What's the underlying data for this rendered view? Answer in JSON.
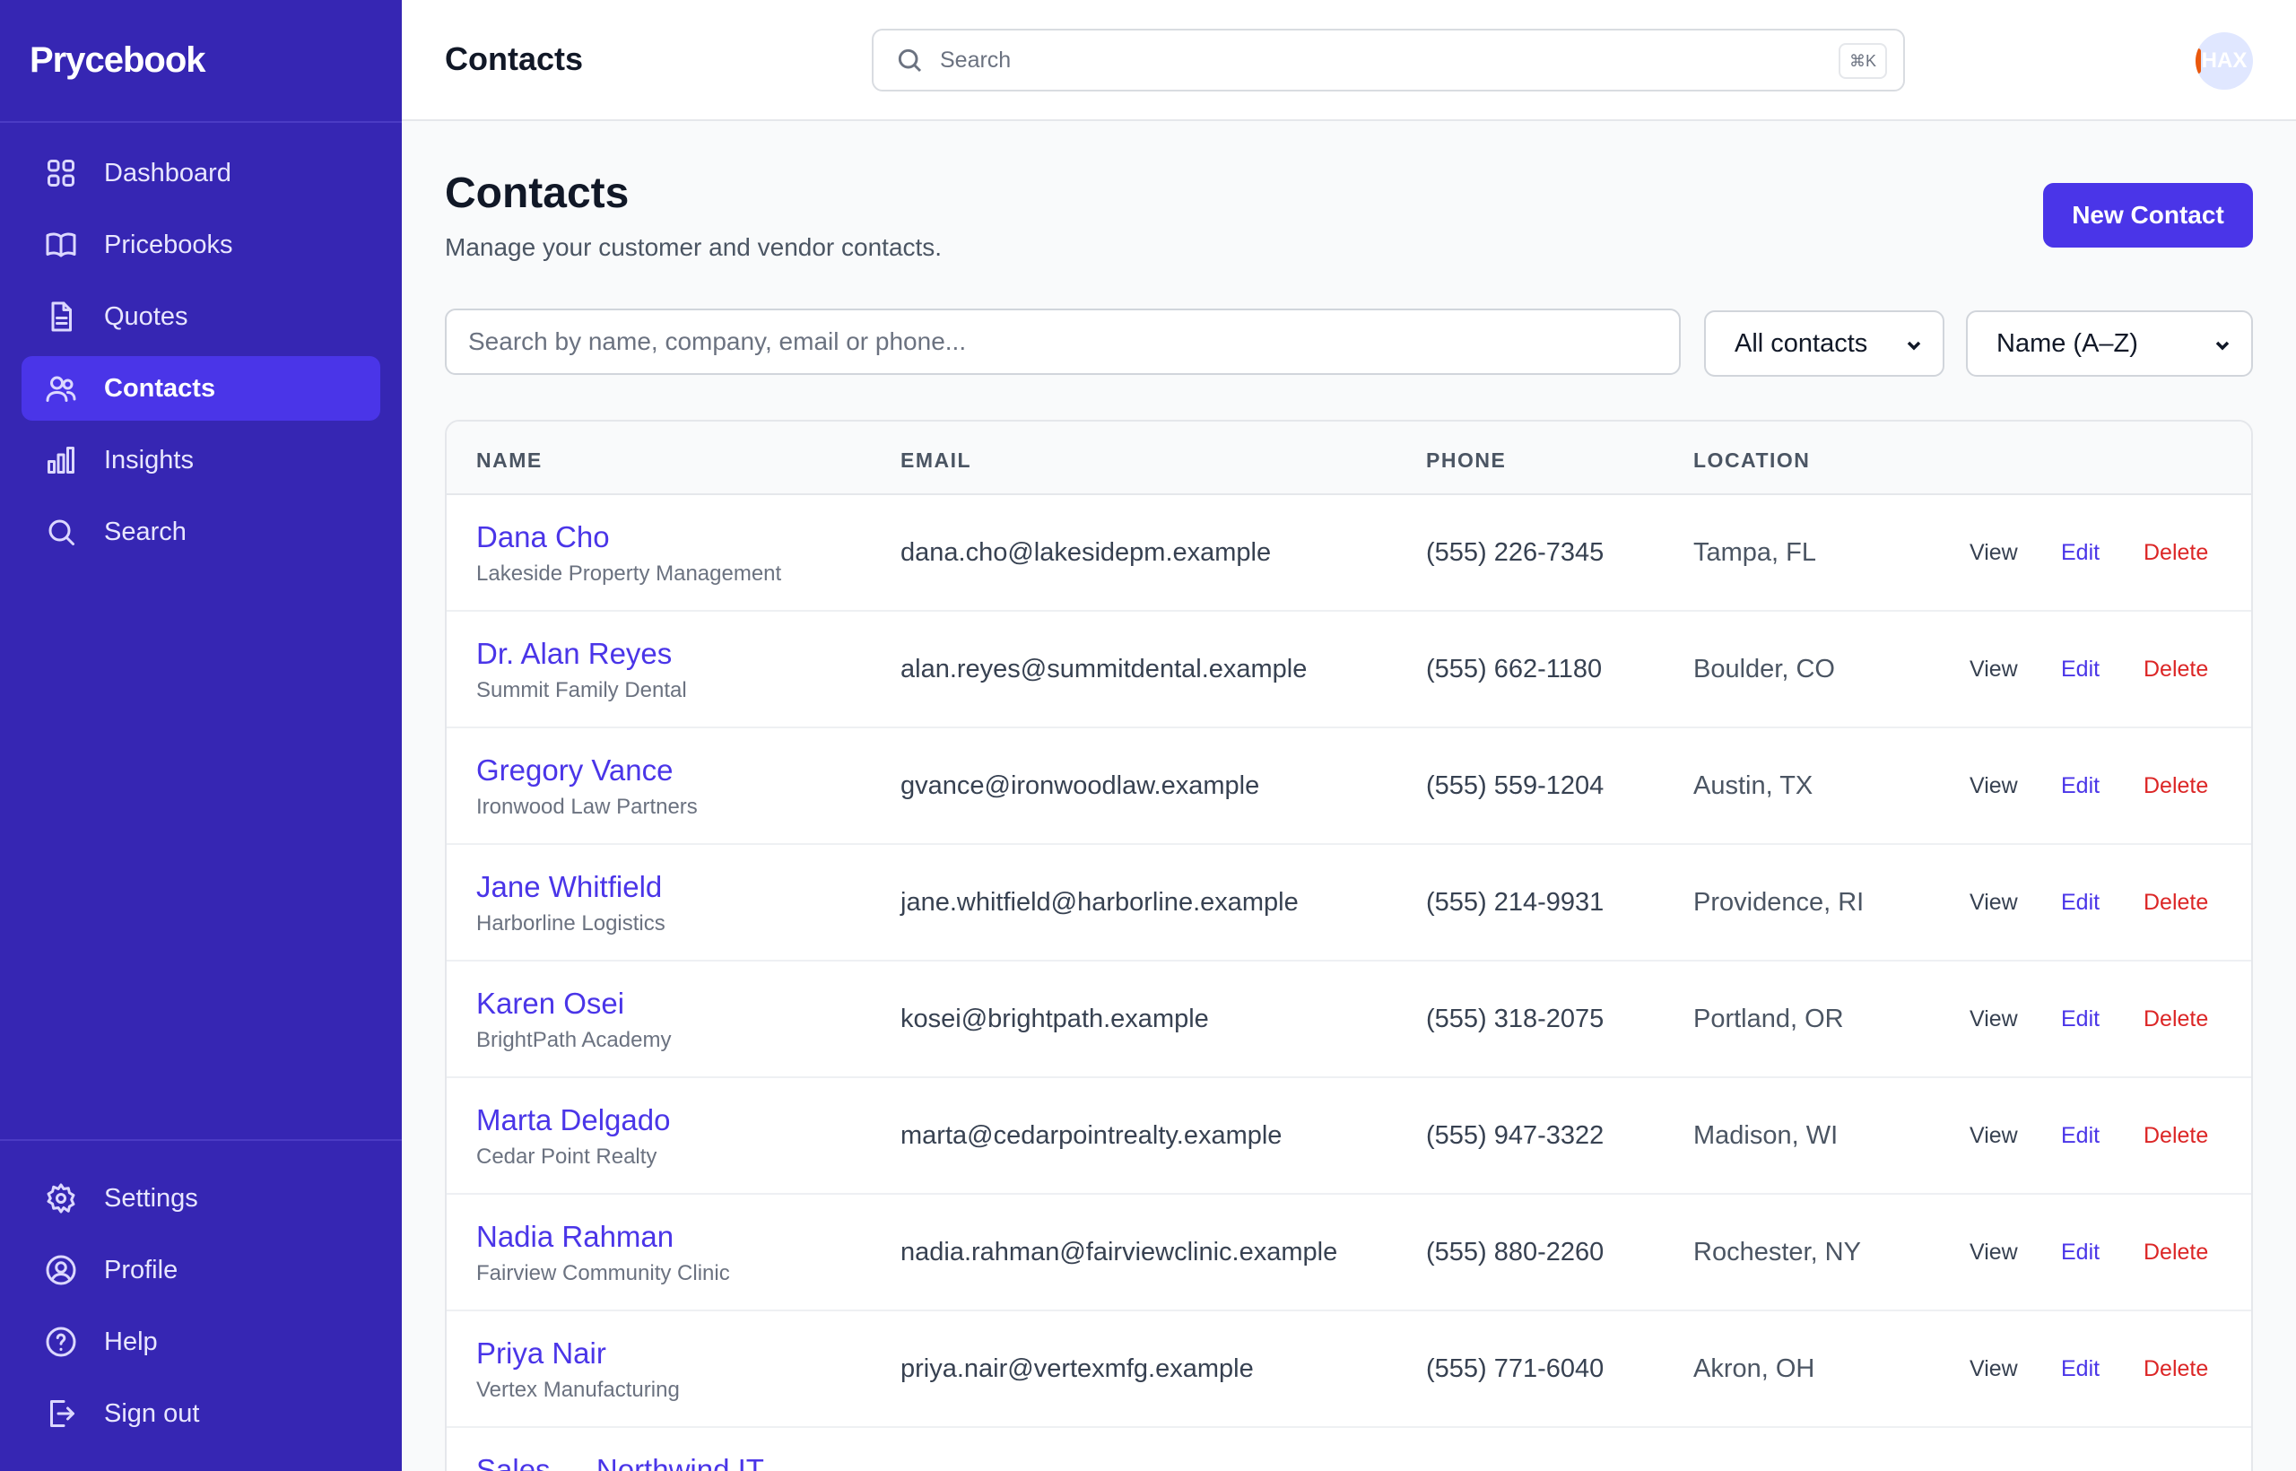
{
  "app": {
    "brand": "Prycebook"
  },
  "sidebar": {
    "items": [
      {
        "label": "Dashboard",
        "icon": "grid-icon"
      },
      {
        "label": "Pricebooks",
        "icon": "book-icon"
      },
      {
        "label": "Quotes",
        "icon": "document-icon"
      },
      {
        "label": "Contacts",
        "icon": "users-icon",
        "active": true
      },
      {
        "label": "Insights",
        "icon": "bar-chart-icon"
      },
      {
        "label": "Search",
        "icon": "search-icon"
      }
    ],
    "bottom_items": [
      {
        "label": "Settings",
        "icon": "gear-icon"
      },
      {
        "label": "Profile",
        "icon": "user-circle-icon"
      },
      {
        "label": "Help",
        "icon": "help-circle-icon"
      },
      {
        "label": "Sign out",
        "icon": "sign-out-icon"
      }
    ]
  },
  "topbar": {
    "title": "Contacts",
    "search_placeholder": "Search",
    "shortcut": "⌘K",
    "avatar_initials": "HAX"
  },
  "page": {
    "title": "Contacts",
    "subtitle": "Manage your customer and vendor contacts.",
    "new_button": "New Contact"
  },
  "filters": {
    "search_placeholder": "Search by name, company, email or phone...",
    "type_selected": "All contacts",
    "sort_selected": "Name (A–Z)"
  },
  "table": {
    "headers": {
      "name": "NAME",
      "email": "EMAIL",
      "phone": "PHONE",
      "location": "LOCATION"
    },
    "actions": {
      "view": "View",
      "edit": "Edit",
      "delete": "Delete"
    },
    "rows": [
      {
        "name": "Dana Cho",
        "company": "Lakeside Property Management",
        "email": "dana.cho@lakesidepm.example",
        "phone": "(555) 226-7345",
        "location": "Tampa, FL"
      },
      {
        "name": "Dr. Alan Reyes",
        "company": "Summit Family Dental",
        "email": "alan.reyes@summitdental.example",
        "phone": "(555) 662-1180",
        "location": "Boulder, CO"
      },
      {
        "name": "Gregory Vance",
        "company": "Ironwood Law Partners",
        "email": "gvance@ironwoodlaw.example",
        "phone": "(555) 559-1204",
        "location": "Austin, TX"
      },
      {
        "name": "Jane Whitfield",
        "company": "Harborline Logistics",
        "email": "jane.whitfield@harborline.example",
        "phone": "(555) 214-9931",
        "location": "Providence, RI"
      },
      {
        "name": "Karen Osei",
        "company": "BrightPath Academy",
        "email": "kosei@brightpath.example",
        "phone": "(555) 318-2075",
        "location": "Portland, OR"
      },
      {
        "name": "Marta Delgado",
        "company": "Cedar Point Realty",
        "email": "marta@cedarpointrealty.example",
        "phone": "(555) 947-3322",
        "location": "Madison, WI"
      },
      {
        "name": "Nadia Rahman",
        "company": "Fairview Community Clinic",
        "email": "nadia.rahman@fairviewclinic.example",
        "phone": "(555) 880-2260",
        "location": "Rochester, NY"
      },
      {
        "name": "Priya Nair",
        "company": "Vertex Manufacturing",
        "email": "priya.nair@vertexmfg.example",
        "phone": "(555) 771-6040",
        "location": "Akron, OH"
      },
      {
        "name": "Sales — Northwind IT",
        "company": "",
        "email": "",
        "phone": "",
        "location": ""
      }
    ]
  }
}
